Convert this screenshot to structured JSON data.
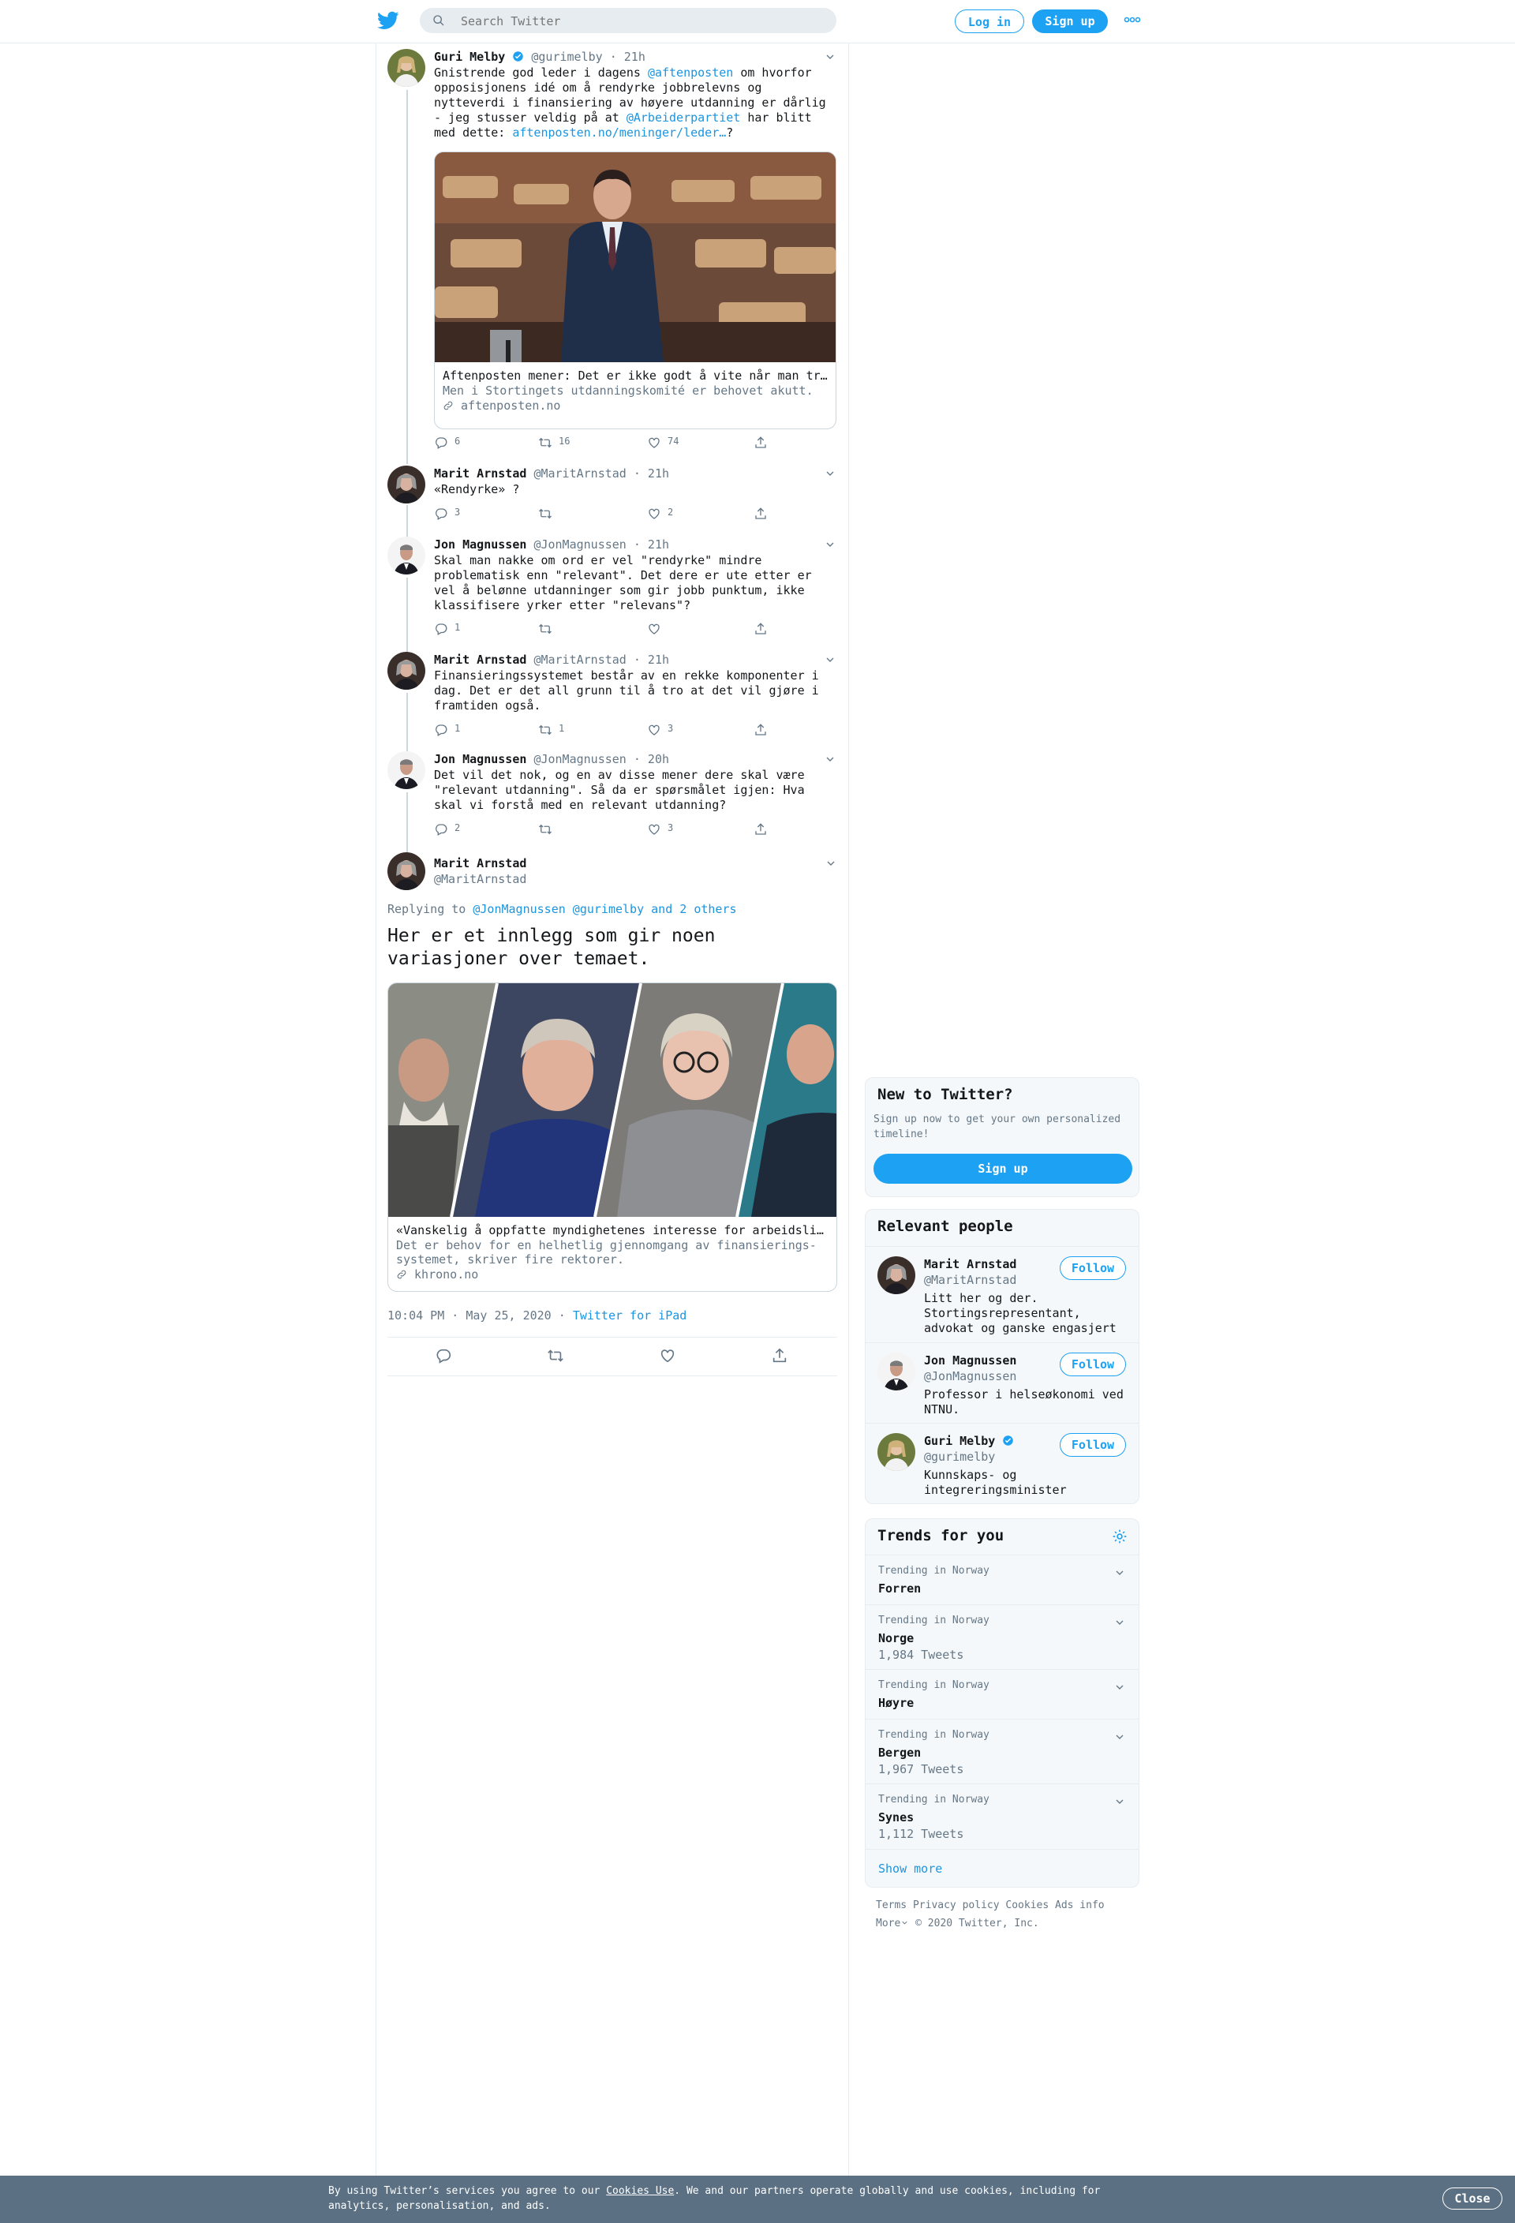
{
  "header": {
    "search_placeholder": "Search Twitter",
    "login_label": "Log in",
    "signup_label": "Sign up"
  },
  "thread": [
    {
      "name": "Guri Melby",
      "handle": "@gurimelby",
      "time": "· 21h",
      "verified": true,
      "text_parts": [
        "Gnistrende god leder i dagens ",
        "@aftenposten",
        " om hvorfor opposisjonens idé om å rendyrke jobbrelevns og nytteverdi i finansiering av høyere utdanning er dårlig - jeg stusser veldig på at ",
        "@Arbeiderpartiet",
        " har blitt med dette: ",
        "aftenposten.no/meninger/leder…",
        "?"
      ],
      "card": {
        "title": "Aftenposten mener: Det er ikke godt å vite når man trenger",
        "description": "Men i Stortingets utdanningskomité er behovet akutt.",
        "domain": "aftenposten.no"
      },
      "replies": "6",
      "retweets": "16",
      "likes": "74"
    },
    {
      "name": "Marit Arnstad",
      "handle": "@MaritArnstad",
      "time": "· 21h",
      "text": "«Rendyrke» ?",
      "replies": "3",
      "retweets": "",
      "likes": "2"
    },
    {
      "name": "Jon Magnussen",
      "handle": "@JonMagnussen",
      "time": "· 21h",
      "text": "Skal man nakke om ord er vel \"rendyrke\" mindre problematisk enn \"relevant\". Det dere er ute etter er vel å belønne utdanninger som gir jobb punktum, ikke klassifisere yrker etter \"relevans\"?",
      "replies": "1",
      "retweets": "",
      "likes": ""
    },
    {
      "name": "Marit Arnstad",
      "handle": "@MaritArnstad",
      "time": "· 21h",
      "text": "Finansieringssystemet består av en rekke komponenter i dag. Det er det all grunn til å tro at det vil gjøre i framtiden også.",
      "replies": "1",
      "retweets": "1",
      "likes": "3"
    },
    {
      "name": "Jon Magnussen",
      "handle": "@JonMagnussen",
      "time": "· 20h",
      "text": "Det vil det nok, og en av disse mener dere skal være \"relevant utdanning\". Så da er spørsmålet igjen: Hva skal vi forstå med en relevant utdanning?",
      "replies": "2",
      "retweets": "",
      "likes": "3"
    }
  ],
  "main_tweet": {
    "name": "Marit Arnstad",
    "handle": "@MaritArnstad",
    "replying_prefix": "Replying to ",
    "replying_to": "@JonMagnussen @gurimelby and 2 others",
    "text": "Her er et innlegg som gir noen variasjoner over temaet.",
    "card": {
      "title": "«Vanskelig å oppfatte myndighetenes interesse for arbeidslivsrelevans»",
      "description": "Det er behov for en helhetlig gjennomgang av finansierings-systemet, skriver fire rektorer.",
      "domain": "khrono.no"
    },
    "timestamp": "10:04 PM · May 25, 2020 · ",
    "source": "Twitter for iPad"
  },
  "sidebar": {
    "new_to_twitter": {
      "title": "New to Twitter?",
      "desc": "Sign up now to get your own personalized timeline!",
      "button": "Sign up"
    },
    "relevant_people": {
      "title": "Relevant people",
      "follow_label": "Follow",
      "people": [
        {
          "name": "Marit Arnstad",
          "handle": "@MaritArnstad",
          "bio": "Litt her og der. Stortingsrepresentant, advokat og ganske engasjert"
        },
        {
          "name": "Jon Magnussen",
          "handle": "@JonMagnussen",
          "bio": "Professor i helseøkonomi ved NTNU."
        },
        {
          "name": "Guri Melby",
          "handle": "@gurimelby",
          "bio": "Kunnskaps- og integreringsminister",
          "verified": true
        }
      ]
    },
    "trends": {
      "title": "Trends for you",
      "items": [
        {
          "meta": "Trending in Norway",
          "name": "Forren",
          "count": ""
        },
        {
          "meta": "Trending in Norway",
          "name": "Norge",
          "count": "1,984 Tweets"
        },
        {
          "meta": "Trending in Norway",
          "name": "Høyre",
          "count": ""
        },
        {
          "meta": "Trending in Norway",
          "name": "Bergen",
          "count": "1,967 Tweets"
        },
        {
          "meta": "Trending in Norway",
          "name": "Synes",
          "count": "1,112 Tweets"
        }
      ],
      "show_more": "Show more"
    },
    "footer": {
      "links": [
        "Terms",
        "Privacy policy",
        "Cookies",
        "Ads info"
      ],
      "more": "More",
      "copyright": "© 2020 Twitter, Inc."
    }
  },
  "cookie_bar": {
    "text_before": "By using Twitter’s services you agree to our ",
    "link": "Cookies Use",
    "text_after": ". We and our partners operate globally and use cookies, including for analytics, personalisation, and ads.",
    "close": "Close"
  },
  "colors": {
    "accent": "#1da1f2",
    "link": "#1b95e0",
    "secondary": "#657786",
    "border": "#e6ecf0",
    "cookie_bg": "#5b7083"
  }
}
